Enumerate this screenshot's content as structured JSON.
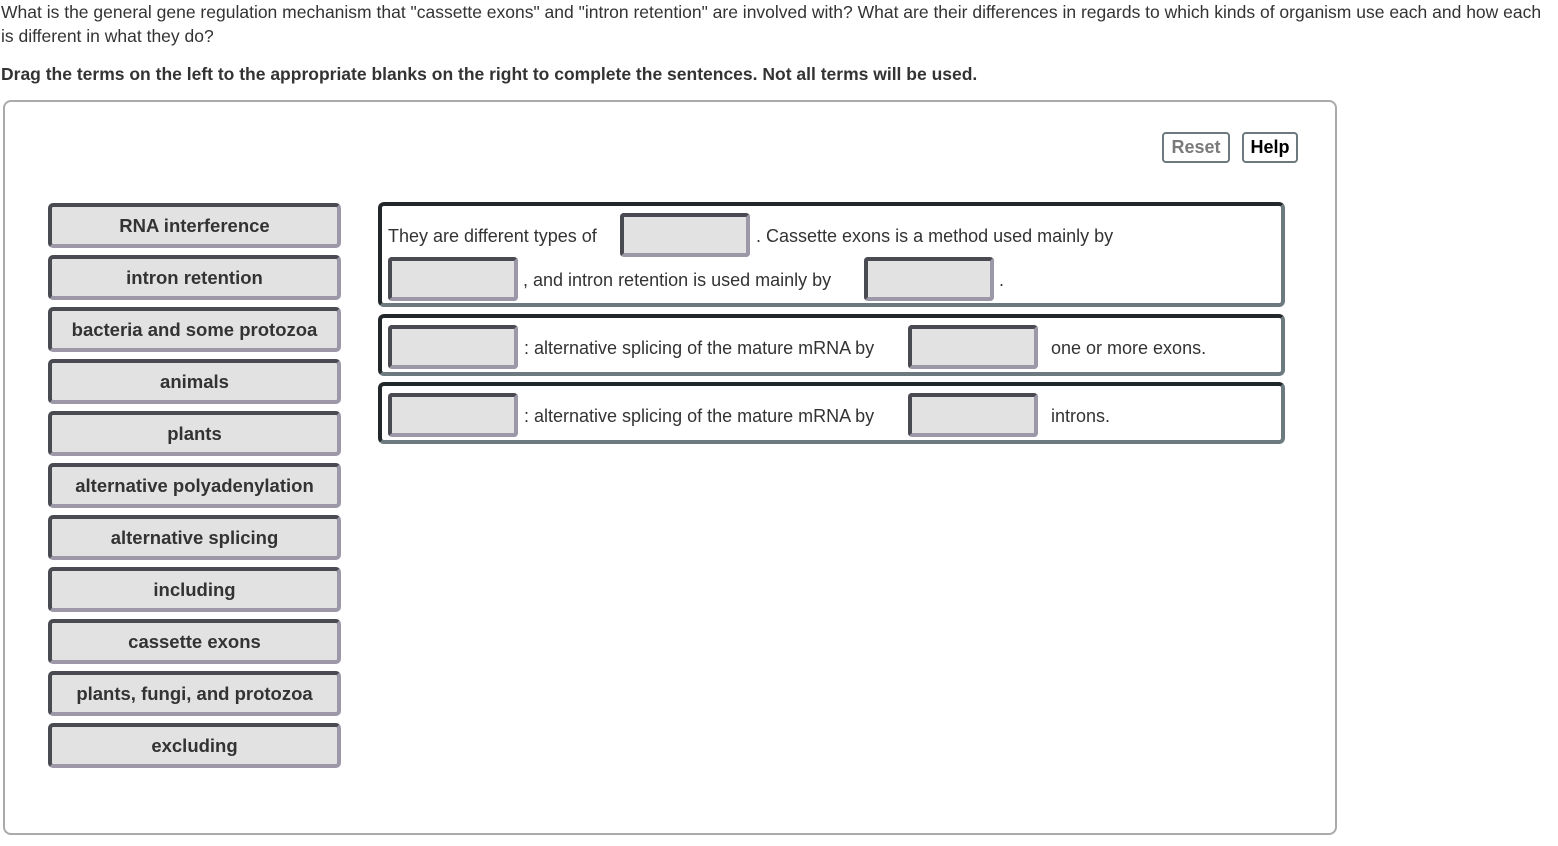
{
  "question": {
    "text": "What is the general gene regulation mechanism that \"cassette exons\" and \"intron retention\" are involved with? What are their differences in regards to which kinds of organism use each and how each is different in what they do?",
    "instruction": "Drag the terms on the left to the appropriate blanks on the right to complete the sentences. Not all terms will be used."
  },
  "toolbar": {
    "reset_label": "Reset",
    "help_label": "Help"
  },
  "terms": [
    "RNA interference",
    "intron retention",
    "bacteria and some protozoa",
    "animals",
    "plants",
    "alternative polyadenylation",
    "alternative splicing",
    "including",
    "cassette exons",
    "plants, fungi, and protozoa",
    "excluding"
  ],
  "sentences": {
    "s1": {
      "part1": "They are different types of",
      "part2": ". Cassette exons is a method used mainly by",
      "part3": ", and intron retention is used mainly by",
      "part4": "."
    },
    "s2": {
      "part1": ": alternative splicing of the mature mRNA by",
      "part2": "one or more exons."
    },
    "s3": {
      "part1": ": alternative splicing of the mature mRNA by",
      "part2": "introns."
    }
  },
  "blanks": {
    "s1_b1": "",
    "s1_b2": "",
    "s1_b3": "",
    "s2_b1": "",
    "s2_b2": "",
    "s3_b1": "",
    "s3_b2": ""
  }
}
